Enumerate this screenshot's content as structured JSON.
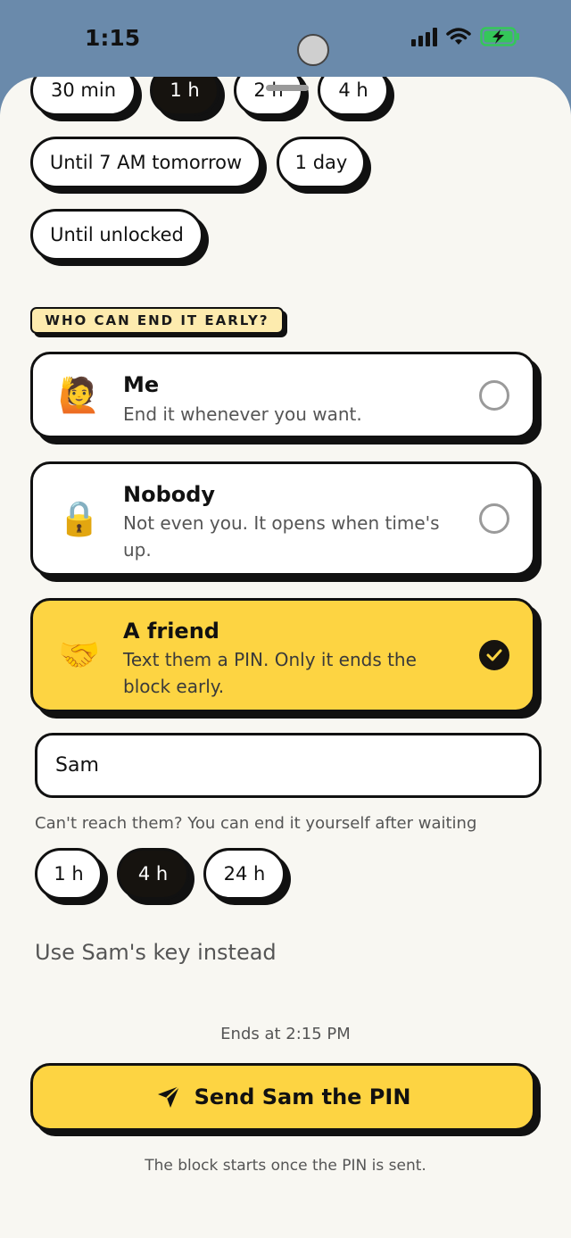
{
  "status_bar": {
    "time": "1:15",
    "signal_icon": "cellular-signal-icon",
    "wifi_icon": "wifi-icon",
    "battery_icon": "battery-charging-icon",
    "battery_color": "#34c759"
  },
  "duration": {
    "options": [
      "30 min",
      "1 h",
      "2 h",
      "4 h",
      "Until 7 AM tomorrow",
      "1 day",
      "Until unlocked"
    ],
    "selected": "1 h"
  },
  "ender_section": {
    "label": "WHO CAN END IT EARLY?",
    "options": [
      {
        "emoji": "🙋",
        "title": "Me",
        "description": "End it whenever you want.",
        "selected": false
      },
      {
        "emoji": "🔒",
        "title": "Nobody",
        "description": "Not even you. It opens when time's up.",
        "selected": false
      },
      {
        "emoji": "🤝",
        "title": "A friend",
        "description": "Text them a PIN. Only it ends the block early.",
        "selected": true
      }
    ]
  },
  "friend": {
    "name_value": "Sam",
    "fallback_hint": "Can't reach them? You can end it yourself after waiting",
    "wait_options": [
      "1 h",
      "4 h",
      "24 h"
    ],
    "wait_selected": "4 h",
    "alt_link": "Use Sam's key instead"
  },
  "footer": {
    "ends_text": "Ends at 2:15 PM",
    "send_icon": "paper-plane-icon",
    "send_button": "Send Sam the PIN",
    "footnote": "The block starts once the PIN is sent."
  },
  "colors": {
    "accent_yellow": "#fdd442",
    "dark": "#16130f",
    "sheet_background": "#f8f7f2",
    "status_bar_background": "#6a8aab"
  }
}
